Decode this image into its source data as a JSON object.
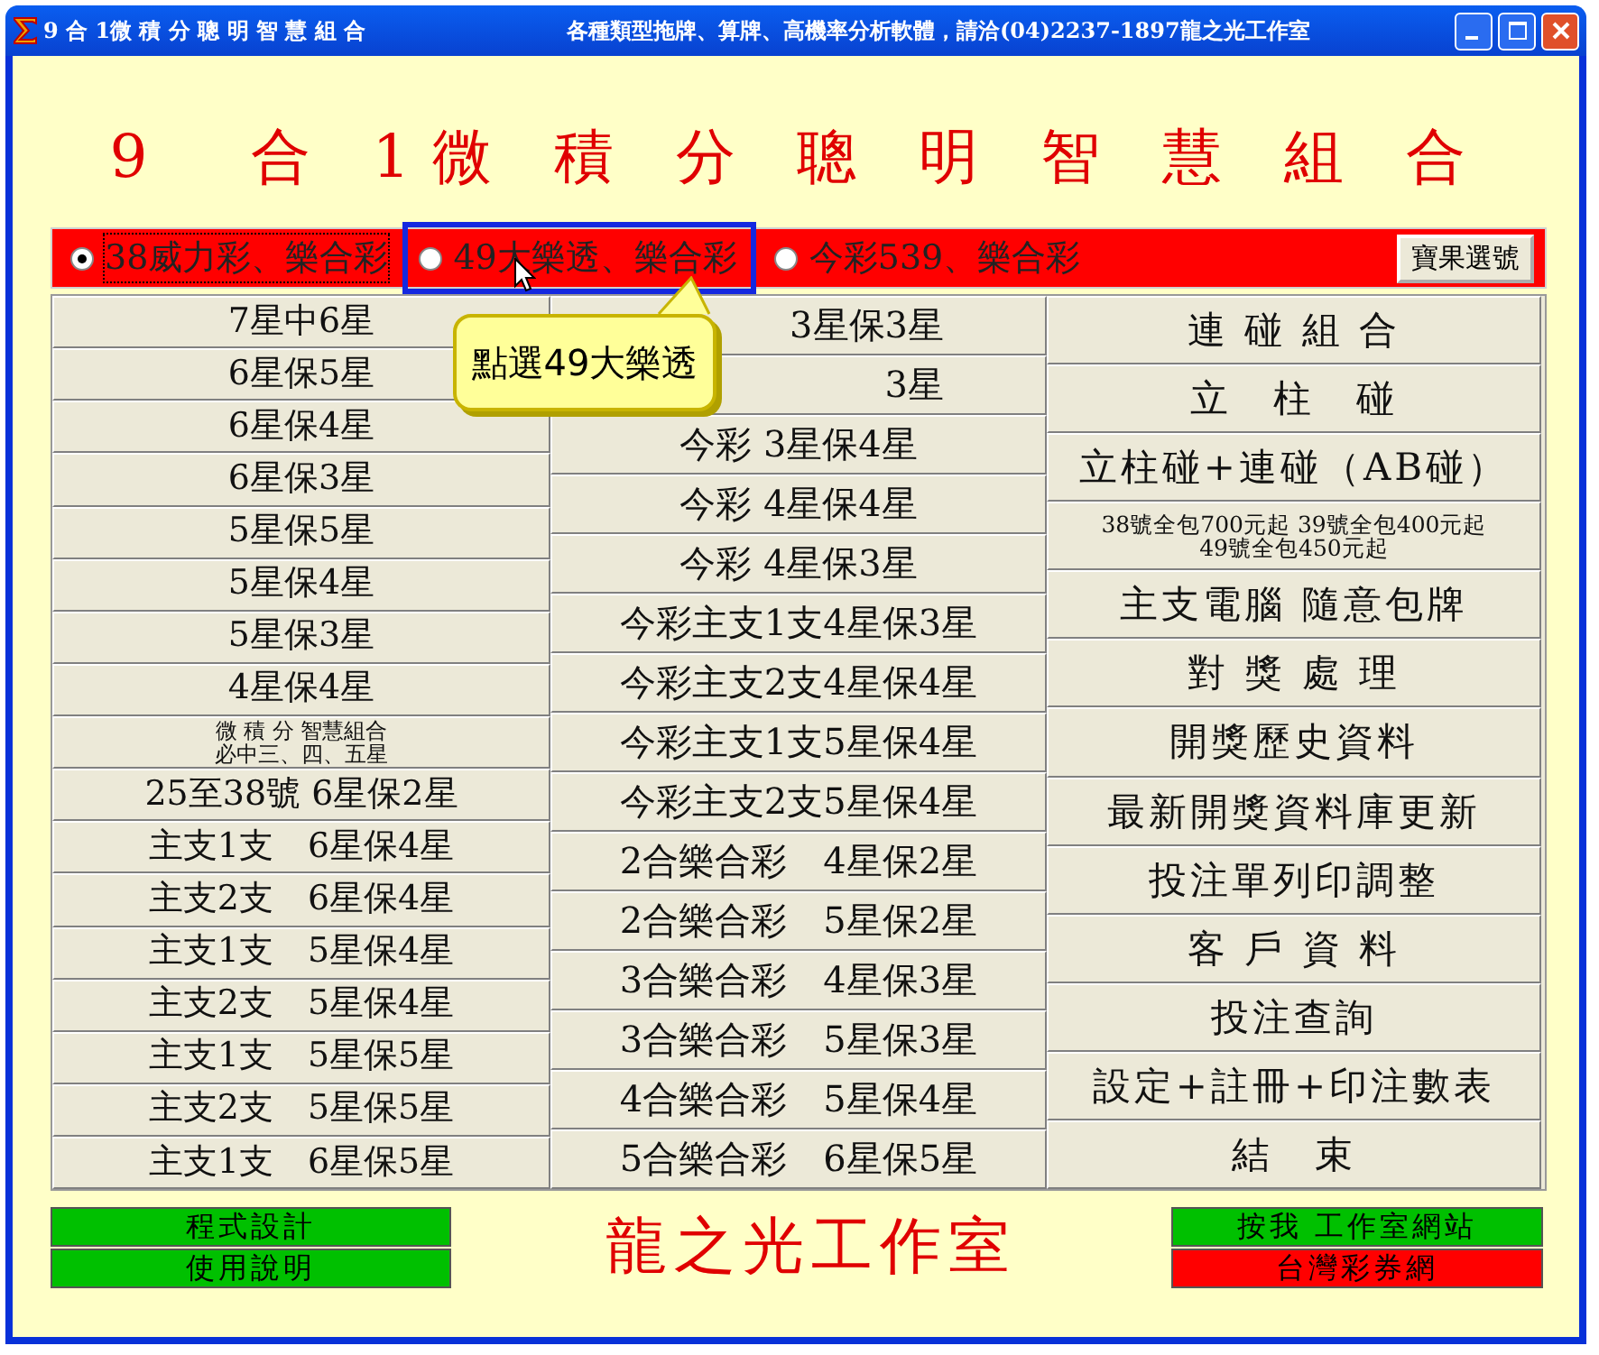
{
  "window": {
    "title": "9 合 1微 積 分 聰 明 智 慧 組 合",
    "caption": "各種類型拖牌、算牌、高機率分析軟體，請洽(04)2237-1897龍之光工作室"
  },
  "heading": "9　合 1微 積 分 聰 明 智 慧 組 合",
  "games": [
    {
      "label": "38威力彩、樂合彩",
      "selected": true
    },
    {
      "label": "49大樂透、樂合彩",
      "selected": false
    },
    {
      "label": "今彩539、樂合彩",
      "selected": false
    }
  ],
  "pick_button": "寶果選號",
  "tooltip": "點選49大樂透",
  "columns": [
    {
      "items": [
        {
          "kind": "single",
          "label": "7星中6星"
        },
        {
          "kind": "single",
          "label": "6星保5星"
        },
        {
          "kind": "single",
          "label": "6星保4星"
        },
        {
          "kind": "single",
          "label": "6星保3星"
        },
        {
          "kind": "single",
          "label": "5星保5星"
        },
        {
          "kind": "single",
          "label": "5星保4星"
        },
        {
          "kind": "single",
          "label": "5星保3星"
        },
        {
          "kind": "single",
          "label": "4星保4星"
        },
        {
          "kind": "double",
          "lines": [
            "微 積 分 智慧組合",
            "必中三、四、五星"
          ]
        },
        {
          "kind": "single",
          "label": "25至38號 6星保2星"
        },
        {
          "kind": "single",
          "label": "主支1支　6星保4星"
        },
        {
          "kind": "single",
          "label": "主支2支　6星保4星"
        },
        {
          "kind": "single",
          "label": "主支1支　5星保4星"
        },
        {
          "kind": "single",
          "label": "主支2支　5星保4星"
        },
        {
          "kind": "single",
          "label": "主支1支　5星保5星"
        },
        {
          "kind": "single",
          "label": "主支2支　5星保5星"
        },
        {
          "kind": "single",
          "label": "主支1支　6星保5星"
        }
      ]
    },
    {
      "items": [
        {
          "kind": "partial",
          "label": "3星保3星"
        },
        {
          "kind": "partial",
          "label": "3星"
        },
        {
          "kind": "single",
          "label": "今彩 3星保4星"
        },
        {
          "kind": "single",
          "label": "今彩 4星保4星"
        },
        {
          "kind": "single",
          "label": "今彩 4星保3星"
        },
        {
          "kind": "single",
          "label": "今彩主支1支4星保3星"
        },
        {
          "kind": "single",
          "label": "今彩主支2支4星保4星"
        },
        {
          "kind": "single",
          "label": "今彩主支1支5星保4星"
        },
        {
          "kind": "single",
          "label": "今彩主支2支5星保4星"
        },
        {
          "kind": "single",
          "label": "2合樂合彩　4星保2星"
        },
        {
          "kind": "single",
          "label": "2合樂合彩　5星保2星"
        },
        {
          "kind": "single",
          "label": "3合樂合彩　4星保3星"
        },
        {
          "kind": "single",
          "label": "3合樂合彩　5星保3星"
        },
        {
          "kind": "single",
          "label": "4合樂合彩　5星保4星"
        },
        {
          "kind": "single",
          "label": "5合樂合彩　6星保5星"
        }
      ]
    },
    {
      "items": [
        {
          "kind": "single",
          "label": "連 碰 組 合"
        },
        {
          "kind": "single",
          "label": "立　柱　碰"
        },
        {
          "kind": "single",
          "label": "立柱碰+連碰（AB碰）"
        },
        {
          "kind": "double",
          "lines": [
            "38號全包700元起 39號全包400元起",
            "49號全包450元起"
          ]
        },
        {
          "kind": "single",
          "label": "主支電腦 隨意包牌"
        },
        {
          "kind": "single",
          "label": "對 獎 處 理"
        },
        {
          "kind": "single",
          "label": "開獎歷史資料"
        },
        {
          "kind": "single",
          "label": "最新開獎資料庫更新"
        },
        {
          "kind": "single",
          "label": "投注單列印調整"
        },
        {
          "kind": "single",
          "label": "客 戶 資 料"
        },
        {
          "kind": "single",
          "label": "投注查詢"
        },
        {
          "kind": "single",
          "label": "設定+註冊+印注數表"
        },
        {
          "kind": "single",
          "label": "結　束"
        }
      ]
    }
  ],
  "footer_left": [
    {
      "label": "程式設計",
      "color": "#00c000"
    },
    {
      "label": "使用說明",
      "color": "#00c000"
    }
  ],
  "brand": "龍之光工作室",
  "footer_right": [
    {
      "label": "按我 工作室網站",
      "color": "#00c000"
    },
    {
      "label": "台灣彩券網",
      "color": "#ff0000"
    }
  ]
}
